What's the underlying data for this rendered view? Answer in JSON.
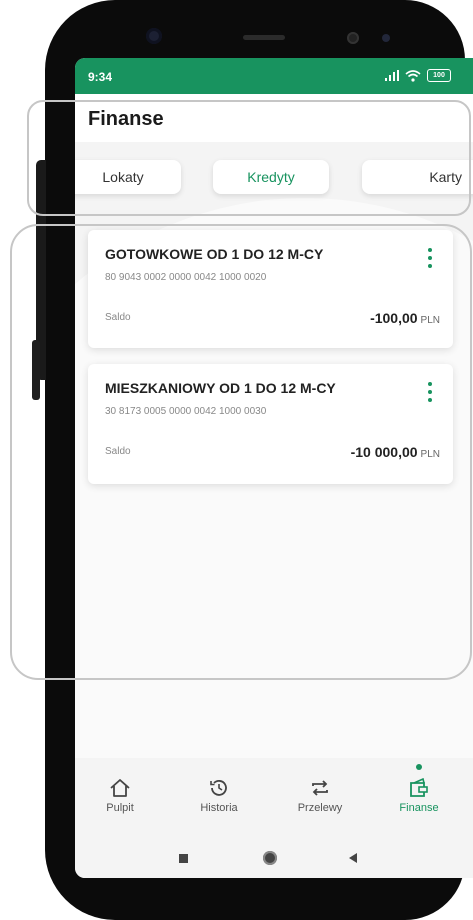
{
  "status_bar": {
    "time": "9:34",
    "battery": "100"
  },
  "header": {
    "title": "Finanse"
  },
  "tabs": [
    {
      "label": "Lokaty",
      "active": false
    },
    {
      "label": "Kredyty",
      "active": true
    },
    {
      "label": "Karty",
      "active": false
    }
  ],
  "loans": [
    {
      "name": "GOTOWKOWE OD 1 DO 12 M-CY",
      "account": "80 9043 0002 0000 0042 1000 0020",
      "saldo_label": "Saldo",
      "amount": "-100,00",
      "currency": "PLN"
    },
    {
      "name": "MIESZKANIOWY OD 1 DO 12 M-CY",
      "account": "30 8173 0005 0000 0042 1000 0030",
      "saldo_label": "Saldo",
      "amount": "-10 000,00",
      "currency": "PLN"
    }
  ],
  "bottom_nav": [
    {
      "label": "Pulpit",
      "icon": "home-icon",
      "active": false
    },
    {
      "label": "Historia",
      "icon": "history-icon",
      "active": false
    },
    {
      "label": "Przelewy",
      "icon": "transfer-icon",
      "active": false
    },
    {
      "label": "Finanse",
      "icon": "wallet-icon",
      "active": true
    }
  ],
  "colors": {
    "accent": "#18935f",
    "background": "#f4f4f4",
    "status_bar": "#18935f"
  }
}
